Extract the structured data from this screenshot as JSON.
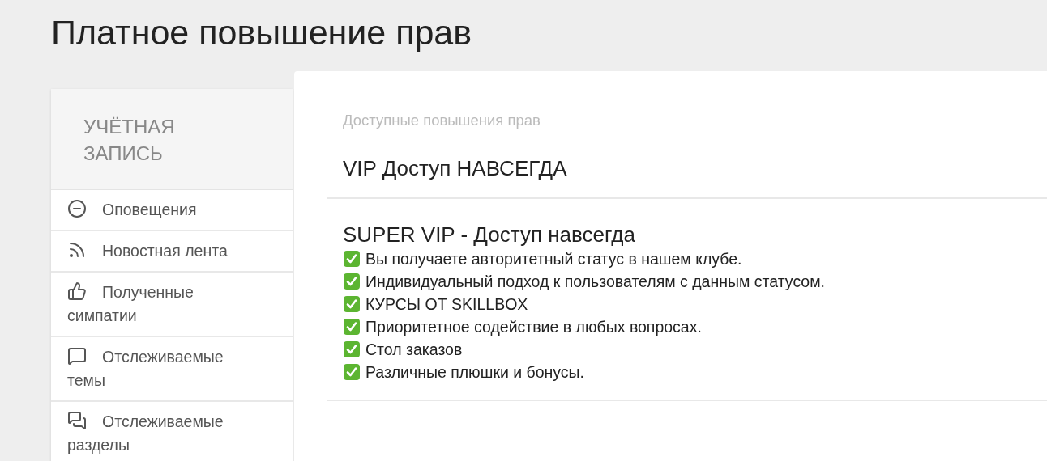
{
  "page_title": "Платное повышение прав",
  "sidebar": {
    "heading": "УЧЁТНАЯ ЗАПИСЬ",
    "items": [
      {
        "label": "Оповещения"
      },
      {
        "label": "Новостная лента"
      },
      {
        "label": "Полученные симпатии"
      },
      {
        "label": "Отслеживаемые темы"
      },
      {
        "label": "Отслеживаемые разделы"
      }
    ]
  },
  "main": {
    "section_label": "Доступные повышения прав",
    "upgrades": [
      {
        "title": "VIP Доступ НАВСЕГДА"
      },
      {
        "title": "SUPER VIP - Доступ навсегда",
        "features": [
          "Вы получаете авторитетный статус в нашем клубе.",
          "Индивидуальный подход к пользователям с данным статусом.",
          "КУРСЫ ОТ SKILLBOX",
          "Приоритетное содействие в любых вопросах.",
          "Стол заказов",
          "Различные плюшки и бонусы."
        ]
      }
    ]
  }
}
